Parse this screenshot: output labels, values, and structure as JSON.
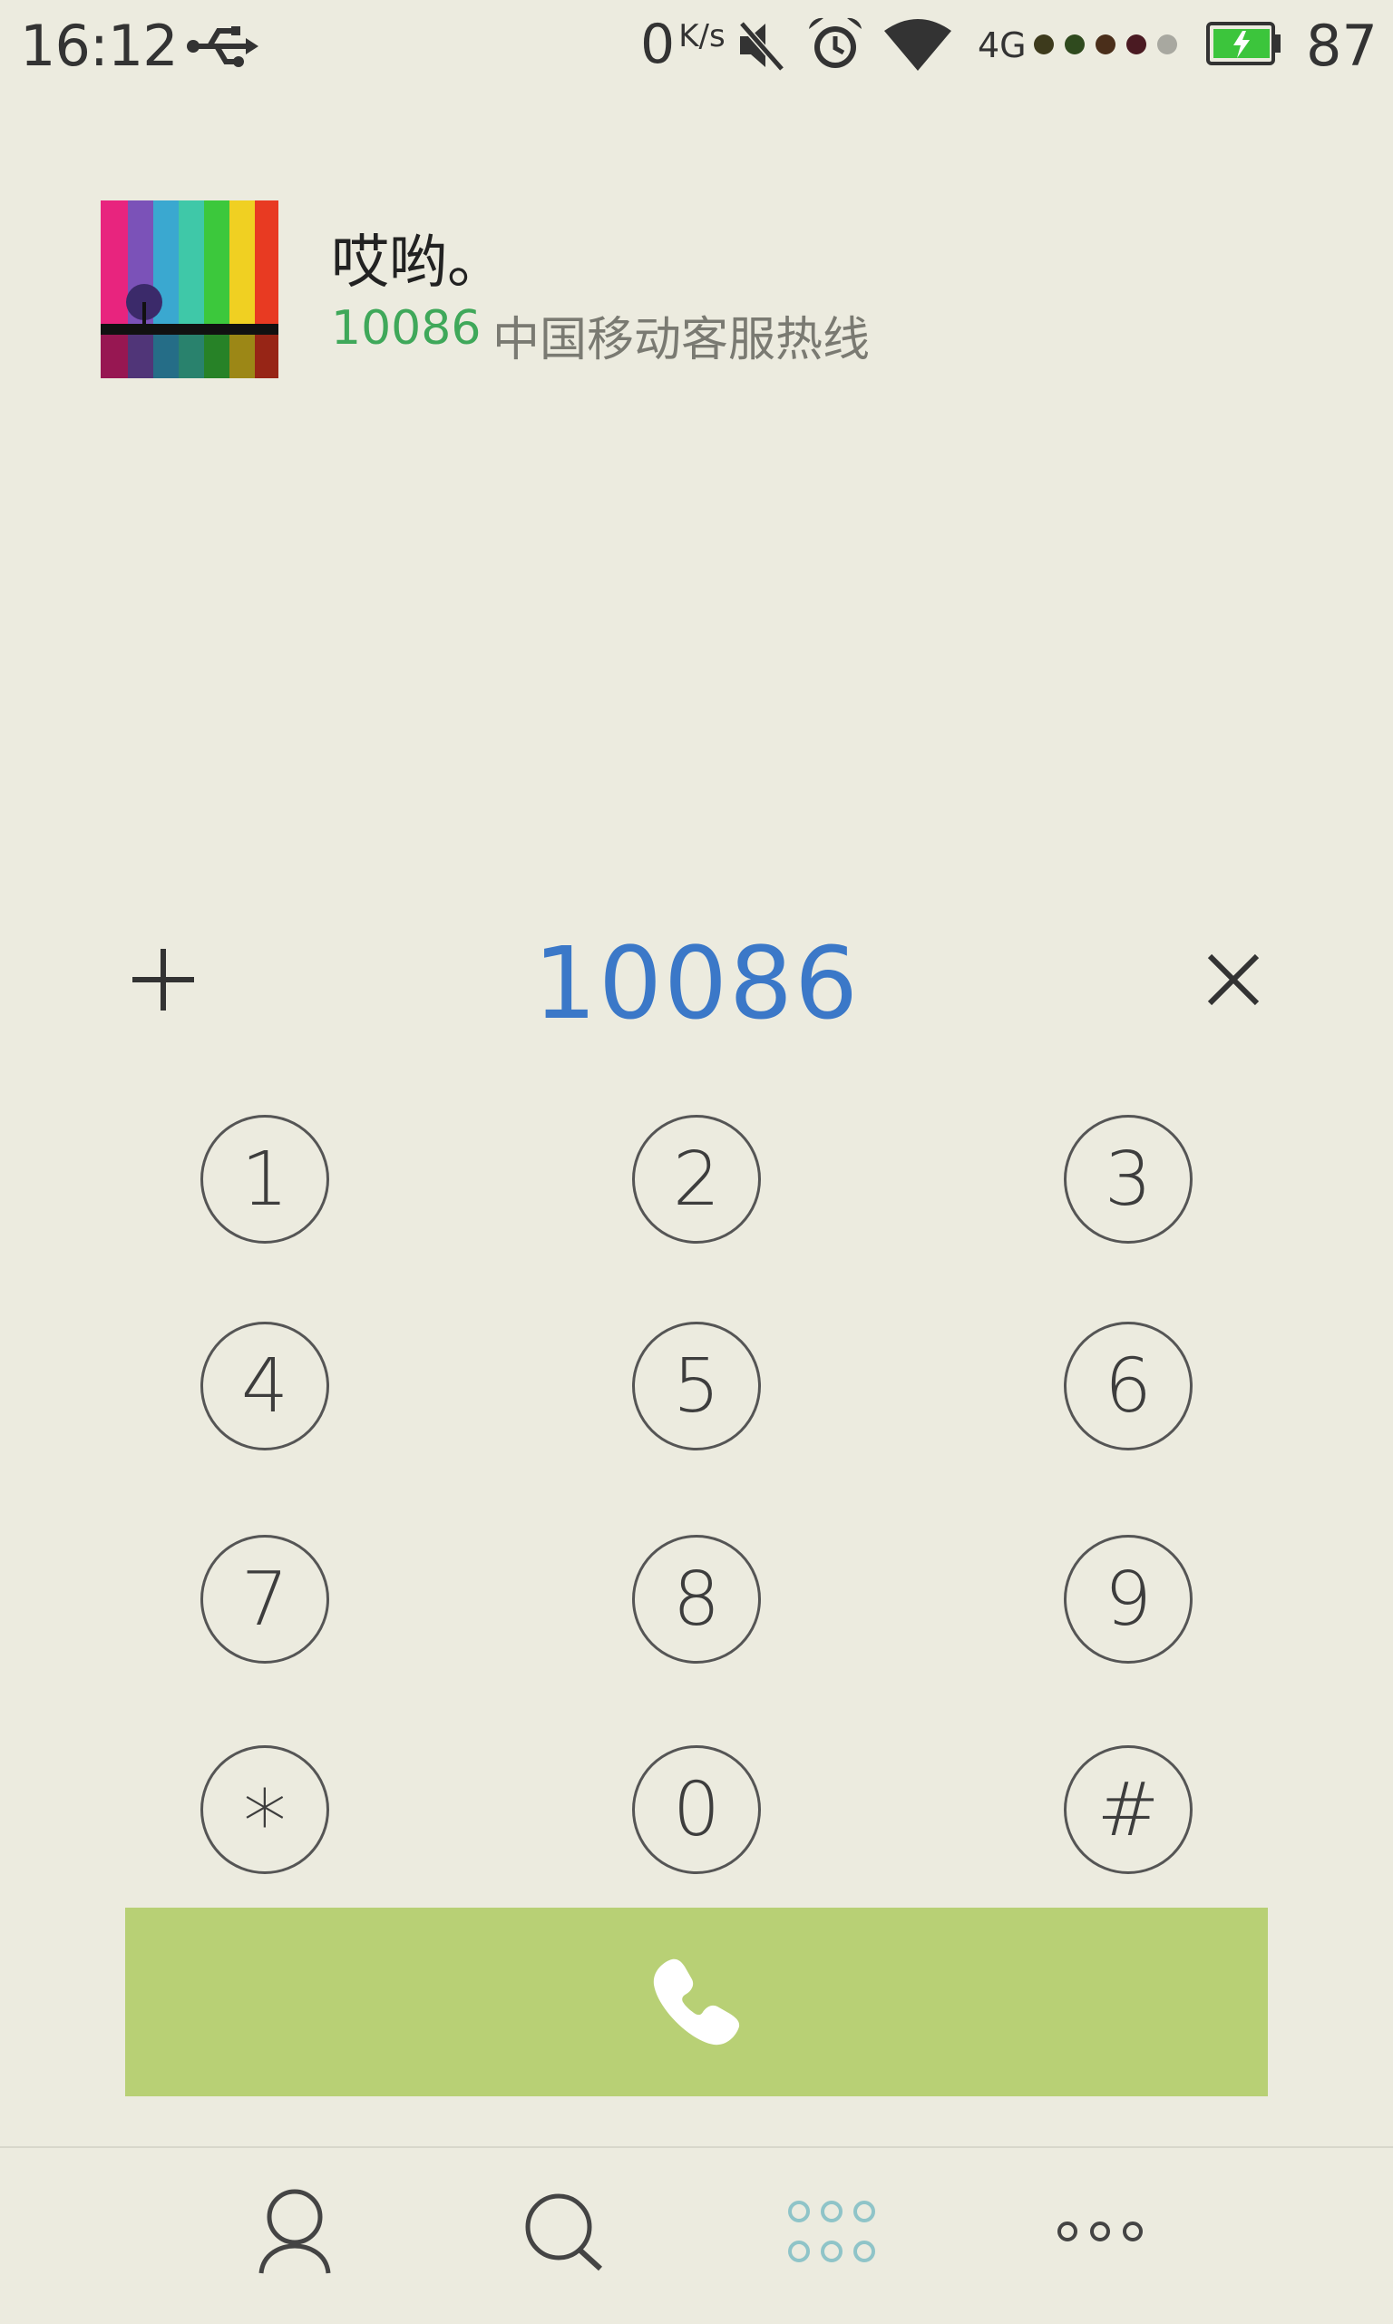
{
  "status_bar": {
    "time": "16:12",
    "net_speed_value": "0",
    "net_speed_unit": "K/s",
    "network": "4G",
    "signal_dots": [
      "#3d3a1c",
      "#2f4a1e",
      "#4a2e1a",
      "#4a1a22",
      "#a8a8a0"
    ],
    "battery": "87",
    "battery_color": "#3cc53c"
  },
  "contact_match": {
    "name": "哎哟。",
    "number": "10086",
    "label": "中国移动客服热线"
  },
  "dialer": {
    "input_value": "10086",
    "add_icon": "plus-icon",
    "clear_icon": "close-icon"
  },
  "keypad": {
    "keys": [
      "1",
      "2",
      "3",
      "4",
      "5",
      "6",
      "7",
      "8",
      "9",
      "*",
      "0",
      "#"
    ]
  },
  "call_button": {
    "icon": "phone-icon",
    "color": "#b8d075"
  },
  "bottom_nav": {
    "items": [
      {
        "icon": "contacts-icon",
        "active": false
      },
      {
        "icon": "search-icon",
        "active": false
      },
      {
        "icon": "dialpad-icon",
        "active": true
      },
      {
        "icon": "more-icon",
        "active": false
      }
    ],
    "active_color": "#8fc4c8"
  }
}
